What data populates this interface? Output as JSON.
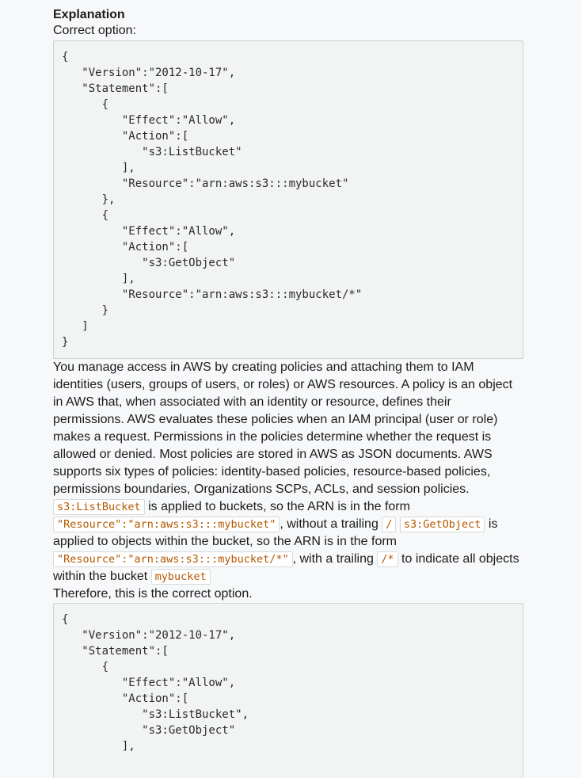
{
  "explanation": {
    "heading": "Explanation",
    "subheading": "Correct option:",
    "code_block_1": "{\n   \"Version\":\"2012-10-17\",\n   \"Statement\":[\n      {\n         \"Effect\":\"Allow\",\n         \"Action\":[\n            \"s3:ListBucket\"\n         ],\n         \"Resource\":\"arn:aws:s3:::mybucket\"\n      },\n      {\n         \"Effect\":\"Allow\",\n         \"Action\":[\n            \"s3:GetObject\"\n         ],\n         \"Resource\":\"arn:aws:s3:::mybucket/*\"\n      }\n   ]\n}",
    "paragraph_1": "You manage access in AWS by creating policies and attaching them to IAM identities (users, groups of users, or roles) or AWS resources. A policy is an object in AWS that, when associated with an identity or resource, defines their permissions. AWS evaluates these policies when an IAM principal (user or role) makes a request. Permissions in the policies determine whether the request is allowed or denied. Most policies are stored in AWS as JSON documents. AWS supports six types of policies: identity-based policies, resource-based policies, permissions boundaries, Organizations SCPs, ACLs, and session policies.",
    "paragraph_2": {
      "code_listbucket": "s3:ListBucket",
      "text_1": " is applied to buckets, so the ARN is in the form ",
      "code_resource_bucket": "\"Resource\":\"arn:aws:s3:::mybucket\"",
      "text_2": ", without a trailing ",
      "code_slash": "/",
      "text_3": " ",
      "code_getobject": "s3:GetObject",
      "text_4": " is applied to objects within the bucket, so the ARN is in the form ",
      "code_resource_objects": "\"Resource\":\"arn:aws:s3:::mybucket/*\"",
      "text_5": ", with a trailing ",
      "code_slash_star": "/*",
      "text_6": " to indicate all objects within the bucket ",
      "code_mybucket": "mybucket"
    },
    "paragraph_3": "Therefore, this is the correct option.",
    "code_block_2": "{\n   \"Version\":\"2012-10-17\",\n   \"Statement\":[\n      {\n         \"Effect\":\"Allow\",\n         \"Action\":[\n            \"s3:ListBucket\",\n            \"s3:GetObject\"\n         ],"
  }
}
